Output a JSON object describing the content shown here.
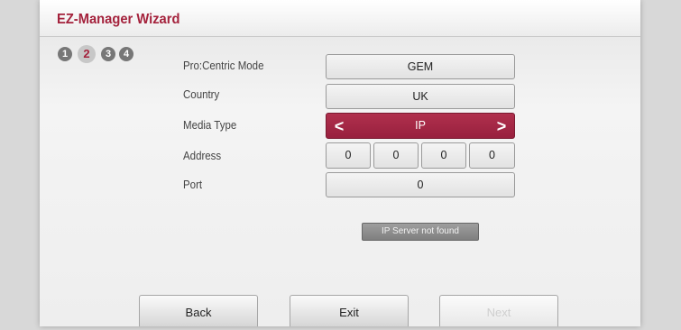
{
  "window": {
    "title": "EZ-Manager Wizard"
  },
  "steps": [
    {
      "num": "1",
      "active": false
    },
    {
      "num": "2",
      "active": true
    },
    {
      "num": "3",
      "active": false
    },
    {
      "num": "4",
      "active": false
    }
  ],
  "form": {
    "procentric_mode": {
      "label": "Pro:Centric Mode",
      "value": "GEM"
    },
    "country": {
      "label": "Country",
      "value": "UK"
    },
    "media_type": {
      "label": "Media Type",
      "value": "IP",
      "prev_arrow": "<",
      "next_arrow": ">"
    },
    "address": {
      "label": "Address",
      "octets": [
        "0",
        "0",
        "0",
        "0"
      ]
    },
    "port": {
      "label": "Port",
      "value": "0"
    }
  },
  "status": {
    "text": "IP Server not found"
  },
  "buttons": {
    "back": "Back",
    "exit": "Exit",
    "next": "Next"
  },
  "colors": {
    "accent": "#a4223c",
    "selected_field": "#a4223c"
  }
}
